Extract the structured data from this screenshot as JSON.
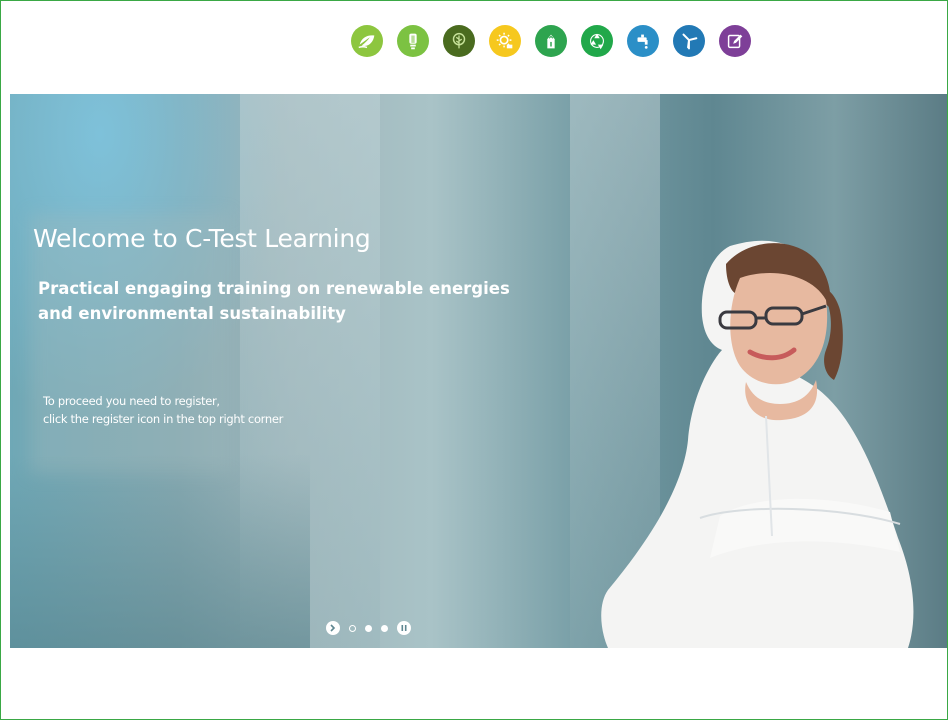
{
  "header": {
    "icons": [
      {
        "name": "leaf-icon",
        "color": "#8dc63f"
      },
      {
        "name": "light-bulb-icon",
        "color": "#7cc242"
      },
      {
        "name": "tree-icon",
        "color": "#4a6b1f"
      },
      {
        "name": "sun-icon",
        "color": "#f6c81e"
      },
      {
        "name": "power-plug-icon",
        "color": "#2ea44f"
      },
      {
        "name": "recycle-icon",
        "color": "#21a84a"
      },
      {
        "name": "water-tap-icon",
        "color": "#2b8fc7"
      },
      {
        "name": "wind-turbine-icon",
        "color": "#2279b5"
      },
      {
        "name": "register-edit-icon",
        "color": "#7e3f98"
      }
    ]
  },
  "hero": {
    "title": "Welcome to C-Test Learning",
    "subtitle_line1": "Practical engaging training on renewable energies",
    "subtitle_line2": "and environmental sustainability",
    "note_line1": "To proceed you need to register,",
    "note_line2": "click the register icon in the top right corner"
  },
  "slider": {
    "slide_count": 3,
    "active_slide": 1,
    "next_icon": "chevron-right-icon",
    "pause_icon": "pause-icon"
  },
  "colors": {
    "frame_border": "#3aa845",
    "hero_text": "#ffffff"
  }
}
